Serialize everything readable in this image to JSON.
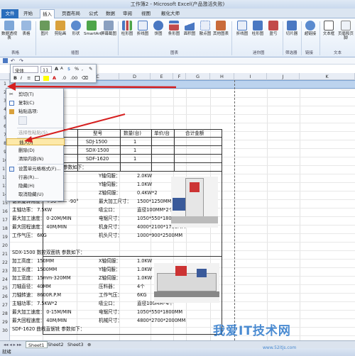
{
  "window": {
    "title": "工作簿2 - Microsoft Excel(产品激活失败)"
  },
  "tabs": [
    "文件",
    "开始",
    "插入",
    "页面布局",
    "公式",
    "数据",
    "审阅",
    "视图",
    "靓化大师"
  ],
  "ribbon": {
    "items": [
      "数据透视表",
      "表格",
      "图片",
      "剪贴画",
      "形状",
      "SmartArt",
      "屏幕截图",
      "柱形图",
      "折线图",
      "饼图",
      "条形图",
      "面积图",
      "散点图",
      "其他图表",
      "折线图",
      "柱形图",
      "盈亏",
      "切片器",
      "超链接",
      "文本框",
      "页眉和页脚"
    ],
    "groups": [
      "表格",
      "插图",
      "图表",
      "迷你图",
      "筛选器",
      "链接",
      "文本"
    ]
  },
  "mini_toolbar": {
    "font": "宋体",
    "size": "11"
  },
  "columns": [
    "A",
    "B",
    "C",
    "D",
    "E",
    "F",
    "G",
    "H",
    "I",
    "J",
    "K"
  ],
  "rows": [
    "1",
    "2",
    "3",
    "4",
    "5",
    "6",
    "7",
    "8",
    "9",
    "10",
    "11",
    "12",
    "13",
    "14",
    "15",
    "16",
    "17",
    "18",
    "19",
    "20",
    "21",
    "22",
    "23",
    "24",
    "25",
    "26",
    "27",
    "28",
    "29",
    "30"
  ],
  "context_menu": {
    "items": [
      "剪切(T)",
      "复制(C)",
      "粘贴选项:",
      "",
      "选择性粘贴(S)...",
      "插入(I)",
      "删除(D)",
      "清除内容(N)",
      "设置单元格格式(F)...",
      "行高(R)...",
      "隐藏(H)",
      "取消隐藏(U)"
    ]
  },
  "table": {
    "header": [
      "型号",
      "数量(台)",
      "单价/台",
      "合计金额"
    ],
    "models": [
      [
        "SDJ-1500",
        "1"
      ],
      [
        "SDX-1500",
        "1"
      ],
      [
        "SDF-1620",
        "1"
      ]
    ],
    "spec_title1": "参数如下：",
    "spec1": [
      [
        "",
        "Y轴伺服：",
        "2.0KW"
      ],
      [
        "±0.8MM",
        "Y轴伺服：",
        "1.0KW"
      ],
      [
        "锯轮直径：     760MM",
        "Z轴伺服：",
        "0.4KW*2"
      ],
      [
        "锯条旋转角度：  +90 —— -90°",
        "最大加工尺寸：",
        "1500*1250MM"
      ],
      [
        "主轴功率：     7.5KW",
        "吸尘口：",
        "直径100MM*2个"
      ],
      [
        "最大加工速度：  0-20M/MIN",
        "电锯尺寸：",
        "1050*550*1800MM"
      ],
      [
        "最大回程速度：  40M/MIN",
        "机身尺寸：",
        "4000*2100*1700MM"
      ],
      [
        "工作气压：     6KG",
        "机头尺寸：",
        "1000*900*2500MM"
      ]
    ],
    "spec_title2": "SDX-1500  数控双面铣   参数如下：",
    "spec2": [
      [
        "加工高度：     150MM",
        "X轴伺服：",
        "1.0KW"
      ],
      [
        "加工长度：     1500MM",
        "Y轴伺服：",
        "1.0KW"
      ],
      [
        "加工宽度：     15mm-320MM",
        "Z轴伺服：",
        "1.0KW"
      ],
      [
        "刀轴直径：     40MM",
        "压料器：",
        "4个"
      ],
      [
        "刀轴转速：     8600R.P.M",
        "工作气压：",
        "6KG"
      ],
      [
        "主轴功率：     7.5KW*2",
        "吸尘口：",
        "直径100MM*4个"
      ],
      [
        "最大加工速度：  0-15M/MIN",
        "电锯尺寸：",
        "1050*550*1800MM"
      ],
      [
        "最大回程速度：  40M/MIN",
        "机械尺寸：",
        "4800*2700*2000MM"
      ],
      [
        "SDF-1620  曲线直锯铣   参数如下：",
        "",
        ""
      ]
    ]
  },
  "sheet_tabs": [
    "Sheet1",
    "Sheet2",
    "Sheet3"
  ],
  "status": "就绪",
  "watermark": {
    "main": "我爱IT技术网",
    "sub": "www.52itjs.com"
  }
}
